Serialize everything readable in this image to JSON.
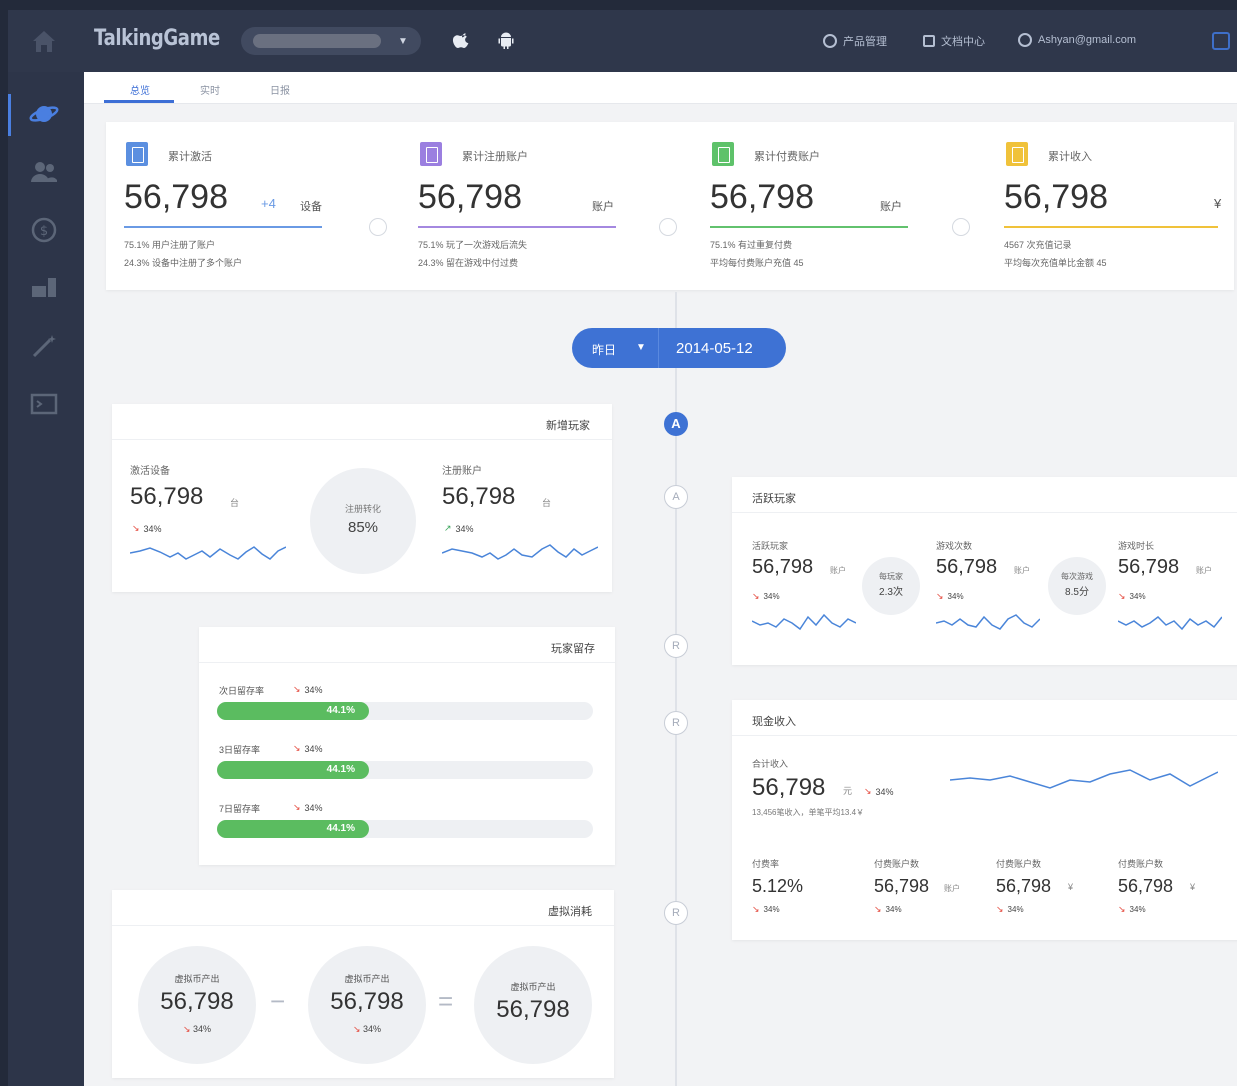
{
  "header": {
    "brand": "TalkingGame",
    "nav_items": [
      {
        "icon": "product-icon",
        "label": "产品管理"
      },
      {
        "icon": "doc-icon",
        "label": "文档中心"
      },
      {
        "icon": "user-icon",
        "label": "Ashyan@gmail.com"
      }
    ],
    "colors": {
      "topbar": "#2f374b",
      "accent": "#3e72d4"
    }
  },
  "tabs": [
    {
      "label": "总览",
      "active": true
    },
    {
      "label": "实时",
      "active": false
    },
    {
      "label": "日报",
      "active": false
    }
  ],
  "kpis": [
    {
      "icon": "device-icon",
      "color": "#5b8fe0",
      "label": "累计激活",
      "value": "56,798",
      "delta": "+4",
      "unit": "设备",
      "bar_color": "#6a9ae4",
      "bar_fill": 0.8,
      "sub1": "75.1% 用户注册了账户",
      "sub2": "24.3% 设备中注册了多个账户"
    },
    {
      "icon": "account-icon",
      "color": "#9b7fe0",
      "label": "累计注册账户",
      "value": "56,798",
      "delta": "",
      "unit": "账户",
      "bar_color": "#a488e0",
      "bar_fill": 0.8,
      "sub1": "75.1% 玩了一次游戏后流失",
      "sub2": "24.3% 留在游戏中付过费"
    },
    {
      "icon": "paying-icon",
      "color": "#5ec26a",
      "label": "累计付费账户",
      "value": "56,798",
      "delta": "",
      "unit": "账户",
      "bar_color": "#62c26e",
      "bar_fill": 0.8,
      "sub1": "75.1% 有过重复付费",
      "sub2": "平均每付费账户充值 45"
    },
    {
      "icon": "income-icon",
      "color": "#f0c23a",
      "label": "累计收入",
      "value": "56,798",
      "delta": "",
      "unit": "¥",
      "bar_color": "#f0c23a",
      "bar_fill": 0.8,
      "sub1": "4567 次充值记录",
      "sub2": "平均每次充值单比金额 45"
    }
  ],
  "date_picker": {
    "label": "昨日",
    "date": "2014-05-12"
  },
  "timeline_nodes": [
    "A",
    "A",
    "R",
    "R",
    "R"
  ],
  "new_players": {
    "title": "新增玩家",
    "left": {
      "label": "激活设备",
      "value": "56,798",
      "unit": "台",
      "change": "34%",
      "dir": "down"
    },
    "center": {
      "label": "注册转化",
      "value": "85%"
    },
    "right": {
      "label": "注册账户",
      "value": "56,798",
      "unit": "台",
      "change": "34%",
      "dir": "up"
    }
  },
  "retention": {
    "title": "玩家留存",
    "rows": [
      {
        "label": "次日留存率",
        "change": "34%",
        "value": "44.1%",
        "fill": 0.44
      },
      {
        "label": "3日留存率",
        "change": "34%",
        "value": "44.1%",
        "fill": 0.44
      },
      {
        "label": "7日留存率",
        "change": "34%",
        "value": "44.1%",
        "fill": 0.44
      }
    ]
  },
  "virtual": {
    "title": "虚拟消耗",
    "items": [
      {
        "label": "虚拟币产出",
        "value": "56,798",
        "change": "34%"
      },
      {
        "label": "虚拟币产出",
        "value": "56,798",
        "change": "34%"
      },
      {
        "label": "虚拟币产出",
        "value": "56,798",
        "change": ""
      }
    ],
    "ops": [
      "−",
      "="
    ]
  },
  "active_players": {
    "title": "活跃玩家",
    "metrics": [
      {
        "label": "活跃玩家",
        "value": "56,798",
        "unit": "账户",
        "change": "34%"
      },
      {
        "label": "游戏次数",
        "value": "56,798",
        "unit": "账户",
        "change": "34%"
      },
      {
        "label": "游戏时长",
        "value": "56,798",
        "unit": "账户",
        "change": "34%"
      }
    ],
    "bubbles": [
      {
        "label": "每玩家",
        "value": "2.3次"
      },
      {
        "label": "每次游戏",
        "value": "8.5分"
      }
    ]
  },
  "revenue": {
    "title": "现金收入",
    "total_label": "合计收入",
    "total_value": "56,798",
    "total_unit": "元",
    "total_change": "34%",
    "total_sub": "13,456笔收入，单笔平均13.4￥",
    "metrics": [
      {
        "label": "付费率",
        "value": "5.12%",
        "unit": "",
        "change": "34%"
      },
      {
        "label": "付费账户数",
        "value": "56,798",
        "unit": "账户",
        "change": "34%"
      },
      {
        "label": "付费账户数",
        "value": "56,798",
        "unit": "¥",
        "change": "34%"
      },
      {
        "label": "付费账户数",
        "value": "56,798",
        "unit": "¥",
        "change": "34%"
      }
    ]
  },
  "sidebar_icons": [
    "planet-icon",
    "users-icon",
    "dollar-icon",
    "devices-icon",
    "magic-wand-icon",
    "terminal-icon"
  ]
}
